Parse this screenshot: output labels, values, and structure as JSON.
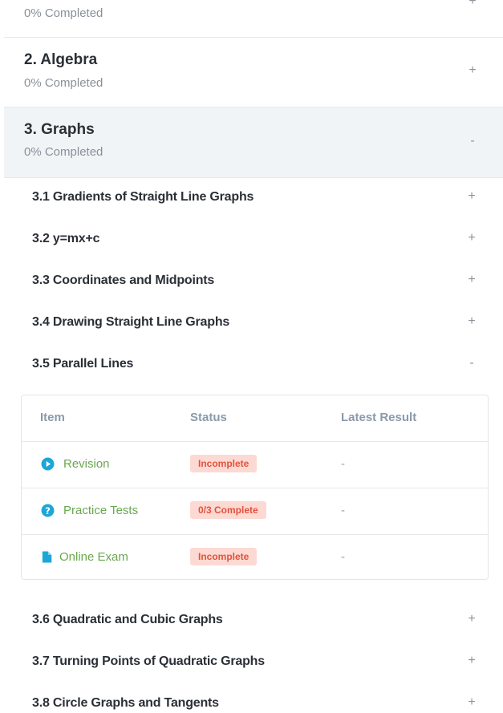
{
  "chapters": [
    {
      "title": "",
      "progress": "0% Completed",
      "toggle": "+"
    },
    {
      "title": "2. Algebra",
      "progress": "0% Completed",
      "toggle": "+"
    },
    {
      "title": "3. Graphs",
      "progress": "0% Completed",
      "toggle": "-"
    }
  ],
  "topics_before": [
    {
      "label": "3.1 Gradients of Straight Line Graphs",
      "toggle": "+"
    },
    {
      "label": "3.2 y=mx+c",
      "toggle": "+"
    },
    {
      "label": "3.3 Coordinates and Midpoints",
      "toggle": "+"
    },
    {
      "label": "3.4 Drawing Straight Line Graphs",
      "toggle": "+"
    },
    {
      "label": "3.5 Parallel Lines",
      "toggle": "-"
    }
  ],
  "items_table": {
    "headers": {
      "item": "Item",
      "status": "Status",
      "result": "Latest Result"
    },
    "rows": [
      {
        "icon": "play-circle-icon",
        "name": "Revision",
        "status": "Incomplete",
        "result": "-"
      },
      {
        "icon": "question-circle-icon",
        "name": "Practice Tests",
        "status": "0/3 Complete",
        "result": "-"
      },
      {
        "icon": "document-icon",
        "name": "Online Exam",
        "status": "Incomplete",
        "result": "-"
      }
    ]
  },
  "topics_after": [
    {
      "label": "3.6 Quadratic and Cubic Graphs",
      "toggle": "+"
    },
    {
      "label": "3.7 Turning Points of Quadratic Graphs",
      "toggle": "+"
    },
    {
      "label": "3.8 Circle Graphs and Tangents",
      "toggle": "+"
    }
  ],
  "colors": {
    "accent_green": "#6aa84f",
    "icon_blue": "#1ea6d9",
    "badge_bg": "#fdd9d3",
    "badge_text": "#e0533d",
    "expanded_bg": "#f1f4f7"
  }
}
